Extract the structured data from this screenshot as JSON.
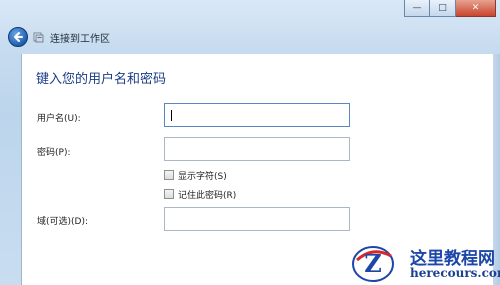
{
  "window": {
    "minimize_glyph": "—",
    "maximize_glyph": "□",
    "close_glyph": "✕"
  },
  "nav": {
    "title": "连接到工作区",
    "back_icon": "back-arrow-icon",
    "wizard_icon": "network-workplace-icon"
  },
  "form": {
    "heading": "键入您的用户名和密码",
    "username_label": "用户名(U):",
    "username_value": "",
    "password_label": "密码(P):",
    "password_value": "",
    "show_chars_label": "显示字符(S)",
    "show_chars_checked": false,
    "remember_label": "记住此密码(R)",
    "remember_checked": false,
    "domain_label": "域(可选)(D):",
    "domain_value": ""
  },
  "watermark": {
    "line1": "这里教程网",
    "line2": "herecours.com",
    "colors": {
      "brand": "#1c46a8",
      "accent": "#d5282d"
    }
  }
}
